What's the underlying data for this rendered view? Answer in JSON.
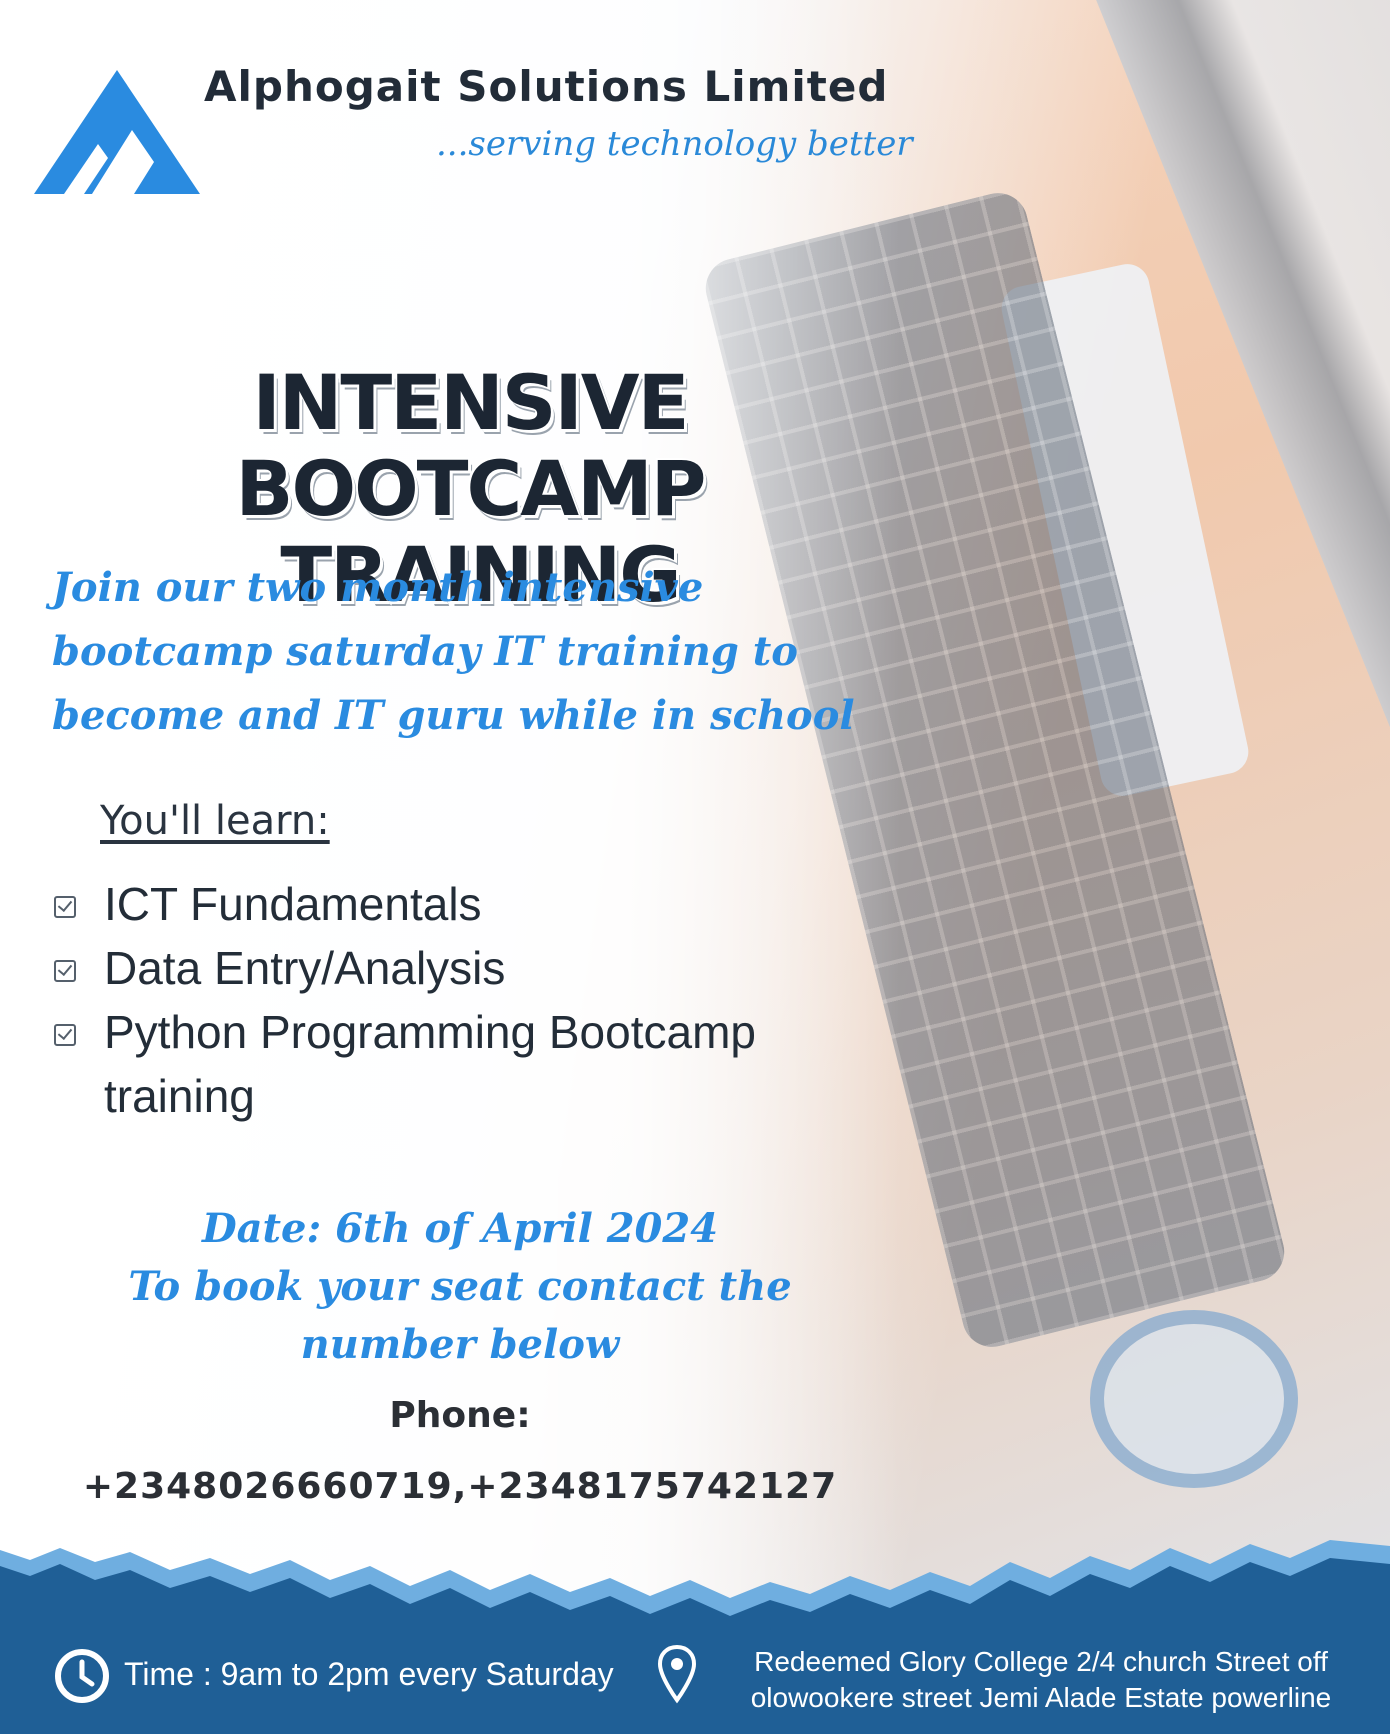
{
  "brand": {
    "company_name": "Alphogait Solutions Limited",
    "tagline": "...serving technology better",
    "accent_color": "#2a8be0",
    "footer_color": "#1f5f96"
  },
  "headline": {
    "line1": "INTENSIVE BOOTCAMP",
    "line2": "TRAINING"
  },
  "intro": "Join our two month intensive bootcamp saturday IT training to become and IT guru while in school",
  "learn": {
    "title": "You'll learn:",
    "items": [
      "ICT Fundamentals",
      "Data Entry/Analysis",
      "Python Programming Bootcamp training"
    ]
  },
  "event": {
    "date": "Date: 6th of April 2024",
    "booking": "To book your seat contact the number below"
  },
  "contact": {
    "phone_label": "Phone:",
    "phone_numbers": "+2348026660719,+2348175742127"
  },
  "footer": {
    "time": "Time : 9am to 2pm every Saturday",
    "address_line1": "Redeemed Glory College 2/4 church Street off",
    "address_line2": "olowookere street  Jemi Alade Estate powerline",
    "icons": [
      "clock-icon",
      "location-pin-icon"
    ]
  }
}
